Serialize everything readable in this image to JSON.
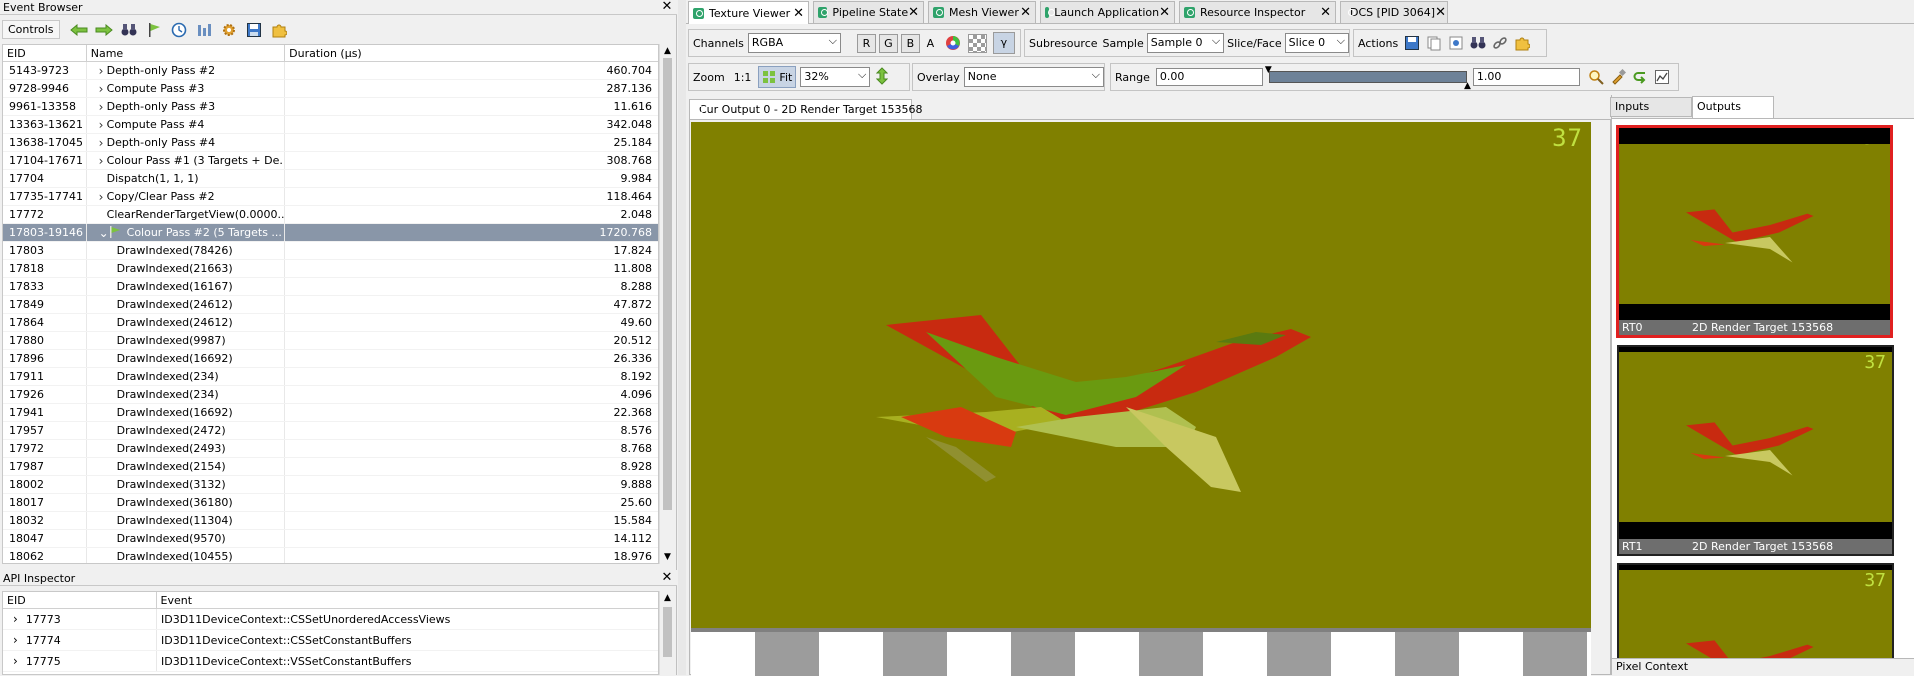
{
  "event_browser": {
    "title": "Event Browser",
    "close": "✕",
    "controls_label": "Controls",
    "columns": [
      "EID",
      "Name",
      "Duration (µs)"
    ],
    "rows": [
      {
        "eid": "5143-9723",
        "name": "Depth-only Pass #2",
        "dur": "460.704",
        "expander": "›",
        "indent": 1
      },
      {
        "eid": "9728-9946",
        "name": "Compute Pass #3",
        "dur": "287.136",
        "expander": "›",
        "indent": 1
      },
      {
        "eid": "9961-13358",
        "name": "Depth-only Pass #3",
        "dur": "11.616",
        "expander": "›",
        "indent": 1
      },
      {
        "eid": "13363-13621",
        "name": "Compute Pass #4",
        "dur": "342.048",
        "expander": "›",
        "indent": 1
      },
      {
        "eid": "13638-17045",
        "name": "Depth-only Pass #4",
        "dur": "25.184",
        "expander": "›",
        "indent": 1
      },
      {
        "eid": "17104-17671",
        "name": "Colour Pass #1 (3 Targets + De...",
        "dur": "308.768",
        "expander": "›",
        "indent": 1
      },
      {
        "eid": "17704",
        "name": "Dispatch(1, 1, 1)",
        "dur": "9.984",
        "expander": "",
        "indent": 1
      },
      {
        "eid": "17735-17741",
        "name": "Copy/Clear Pass #2",
        "dur": "118.464",
        "expander": "›",
        "indent": 1
      },
      {
        "eid": "17772",
        "name": "ClearRenderTargetView(0.0000...",
        "dur": "2.048",
        "expander": "",
        "indent": 1
      },
      {
        "eid": "17803-19146",
        "name": "Colour Pass #2 (5 Targets ...",
        "dur": "1720.768",
        "expander": "⌄",
        "indent": 1,
        "selected": true
      },
      {
        "eid": "17803",
        "name": "DrawIndexed(78426)",
        "dur": "17.824",
        "expander": "",
        "indent": 2
      },
      {
        "eid": "17818",
        "name": "DrawIndexed(21663)",
        "dur": "11.808",
        "expander": "",
        "indent": 2
      },
      {
        "eid": "17833",
        "name": "DrawIndexed(16167)",
        "dur": "8.288",
        "expander": "",
        "indent": 2
      },
      {
        "eid": "17849",
        "name": "DrawIndexed(24612)",
        "dur": "47.872",
        "expander": "",
        "indent": 2
      },
      {
        "eid": "17864",
        "name": "DrawIndexed(24612)",
        "dur": "49.60",
        "expander": "",
        "indent": 2
      },
      {
        "eid": "17880",
        "name": "DrawIndexed(9987)",
        "dur": "20.512",
        "expander": "",
        "indent": 2
      },
      {
        "eid": "17896",
        "name": "DrawIndexed(16692)",
        "dur": "26.336",
        "expander": "",
        "indent": 2
      },
      {
        "eid": "17911",
        "name": "DrawIndexed(234)",
        "dur": "8.192",
        "expander": "",
        "indent": 2
      },
      {
        "eid": "17926",
        "name": "DrawIndexed(234)",
        "dur": "4.096",
        "expander": "",
        "indent": 2
      },
      {
        "eid": "17941",
        "name": "DrawIndexed(16692)",
        "dur": "22.368",
        "expander": "",
        "indent": 2
      },
      {
        "eid": "17957",
        "name": "DrawIndexed(2472)",
        "dur": "8.576",
        "expander": "",
        "indent": 2
      },
      {
        "eid": "17972",
        "name": "DrawIndexed(2493)",
        "dur": "8.768",
        "expander": "",
        "indent": 2
      },
      {
        "eid": "17987",
        "name": "DrawIndexed(2154)",
        "dur": "8.928",
        "expander": "",
        "indent": 2
      },
      {
        "eid": "18002",
        "name": "DrawIndexed(3132)",
        "dur": "9.888",
        "expander": "",
        "indent": 2
      },
      {
        "eid": "18017",
        "name": "DrawIndexed(36180)",
        "dur": "25.60",
        "expander": "",
        "indent": 2
      },
      {
        "eid": "18032",
        "name": "DrawIndexed(11304)",
        "dur": "15.584",
        "expander": "",
        "indent": 2
      },
      {
        "eid": "18047",
        "name": "DrawIndexed(9570)",
        "dur": "14.112",
        "expander": "",
        "indent": 2
      },
      {
        "eid": "18062",
        "name": "DrawIndexed(10455)",
        "dur": "18.976",
        "expander": "",
        "indent": 2
      }
    ]
  },
  "api_inspector": {
    "title": "API Inspector",
    "close": "✕",
    "columns": [
      "EID",
      "Event"
    ],
    "rows": [
      {
        "eid": "17773",
        "event": "ID3D11DeviceContext::CSSetUnorderedAccessViews"
      },
      {
        "eid": "17774",
        "event": "ID3D11DeviceContext::CSSetConstantBuffers"
      },
      {
        "eid": "17775",
        "event": "ID3D11DeviceContext::VSSetConstantBuffers"
      }
    ]
  },
  "tabs": [
    {
      "label": "Texture Viewer",
      "active": true
    },
    {
      "label": "Pipeline State"
    },
    {
      "label": "Mesh Viewer"
    },
    {
      "label": "Launch Application"
    },
    {
      "label": "Resource Inspector"
    },
    {
      "label": "DCS [PID 3064]"
    }
  ],
  "toolbar": {
    "channels_label": "Channels",
    "channels_value": "RGBA",
    "chan_r": "R",
    "chan_g": "G",
    "chan_b": "B",
    "chan_a": "A",
    "gamma": "γ",
    "subresource_label": "Subresource",
    "sample_label": "Sample",
    "sample_value": "Sample 0",
    "slice_label": "Slice/Face",
    "slice_value": "Slice 0",
    "actions_label": "Actions",
    "zoom_label": "Zoom",
    "zoom_1to1": "1:1",
    "fit_label": "Fit",
    "zoom_value": "32%",
    "overlay_label": "Overlay",
    "overlay_value": "None",
    "range_label": "Range",
    "range_min": "0.00",
    "range_max": "1.00"
  },
  "viewer": {
    "tab_label": "Cur Output 0 - 2D Render Target 153568",
    "watermark": "37"
  },
  "side": {
    "tab_inputs": "Inputs",
    "tab_outputs": "Outputs",
    "thumbs": [
      {
        "slot": "RT0",
        "name": "2D Render Target 153568",
        "selected": true
      },
      {
        "slot": "RT1",
        "name": "2D Render Target 153568"
      }
    ],
    "pixel_context": "Pixel Context"
  },
  "colors": {
    "target_bg": "#808000",
    "selection": "#8996a8",
    "tab_icon": "#2fa36b",
    "selected_thumb_border": "#e02020"
  }
}
